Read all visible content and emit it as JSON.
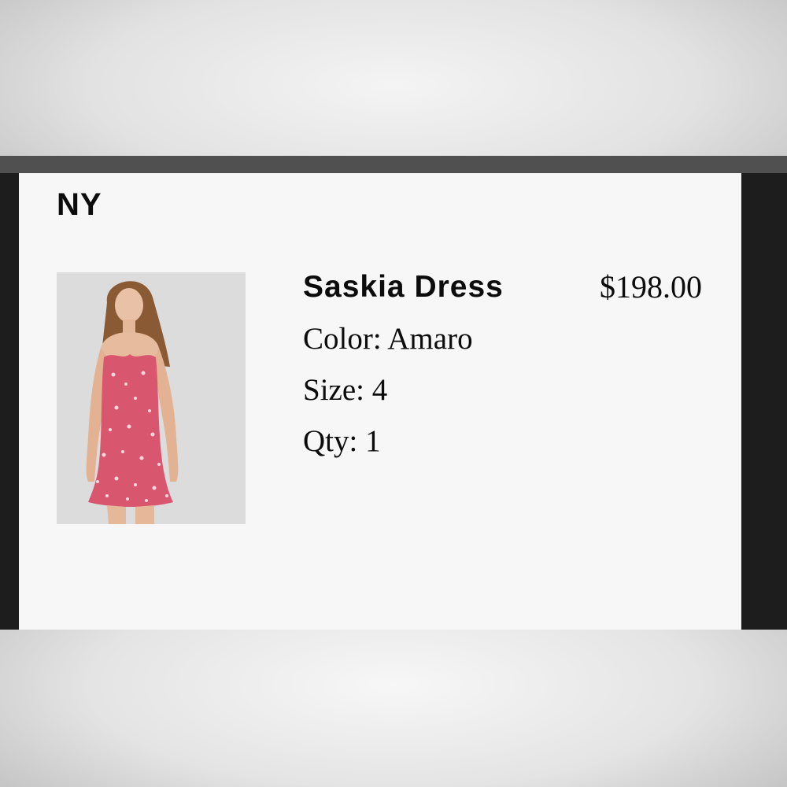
{
  "order": {
    "store_label": "NY",
    "item": {
      "name": "Saskia Dress",
      "price": "$198.00",
      "color_text": "Color: Amaro",
      "size_text": "Size: 4",
      "qty_text": "Qty: 1",
      "image_icon": "product-photo-dress"
    }
  },
  "colors": {
    "dress": "#d9566f",
    "background": "#f7f7f7",
    "frame": "#1d1d1d"
  }
}
